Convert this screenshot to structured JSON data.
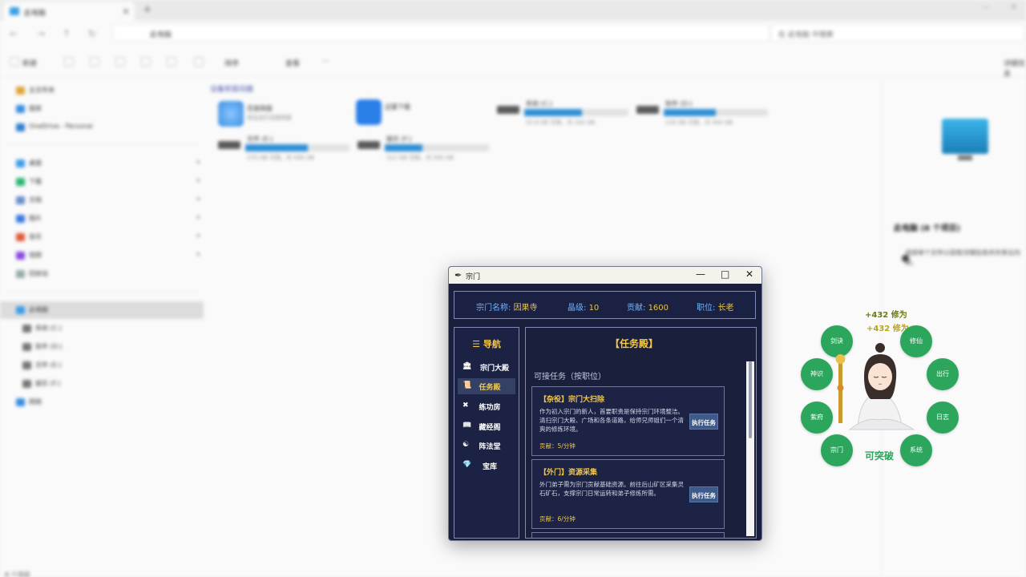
{
  "explorer": {
    "tab_title": "此电脑",
    "path": "此电脑",
    "search_placeholder": "在 此电脑 中搜索",
    "toolbar": {
      "new": "新建",
      "sort": "排序",
      "view": "查看",
      "more": "···",
      "details": "详细信息"
    },
    "sidebar": {
      "top_items": [
        "主文件夹",
        "图库",
        "OneDrive - Personal"
      ],
      "pinned_items": [
        "桌面",
        "下载",
        "文档",
        "图片",
        "音乐",
        "视频",
        "回收站"
      ],
      "this_pc": "此电脑",
      "drives": [
        "系统 (C:)",
        "软件 (D:)",
        "文件 (E:)",
        "娱乐 (F:)"
      ],
      "network": "网络"
    },
    "section_title": "设备和驱动器",
    "apps": [
      {
        "name": "百度网盘",
        "sub": "双击运行百度网盘"
      },
      {
        "name": "迅雷下载",
        "sub": ""
      }
    ],
    "drives": [
      {
        "name": "系统 (C:)",
        "free": "55.8 GB 可用，共 200 GB",
        "used": 0.55
      },
      {
        "name": "软件 (D:)",
        "free": "218 GB 可用，共 400 GB",
        "used": 0.5
      },
      {
        "name": "文件 (E:)",
        "free": "270 GB 可用，共 499 GB",
        "used": 0.6
      },
      {
        "name": "娱乐 (F:)",
        "free": "312 GB 可用，共 500 GB",
        "used": 0.36
      }
    ],
    "details": {
      "title": "此电脑 (8 个项目)",
      "info": "选择单个文件以获取详细信息并共享云内容。"
    },
    "status": "8 个项目"
  },
  "sect_window": {
    "title": "宗门",
    "info": {
      "name_label": "宗门名称:",
      "name_value": "因果寺",
      "level_label": "晶级:",
      "level_value": "10",
      "contrib_label": "贡献:",
      "contrib_value": "1600",
      "position_label": "职位:",
      "position_value": "长老"
    },
    "nav": {
      "heading": "☰ 导航",
      "items": [
        {
          "label": "宗门大殿",
          "icon": "🏛"
        },
        {
          "label": "任务殿",
          "icon": "📜"
        },
        {
          "label": "练功房",
          "icon": "✖"
        },
        {
          "label": "藏经阁",
          "icon": "📖"
        },
        {
          "label": "阵法堂",
          "icon": "☯"
        },
        {
          "label": "宝库",
          "icon": "💎"
        }
      ]
    },
    "content": {
      "title": "【任务殿】",
      "subtitle": "可接任务（按职位）",
      "tasks": [
        {
          "title": "【杂役】宗门大扫除",
          "desc": "作为初入宗门的新人，首要职责是保持宗门环境整洁。清扫宗门大殿、广场和各条道路，给师兄师姐们一个清爽的修炼环境。",
          "contrib": "贡献：5/分钟",
          "button": "执行任务"
        },
        {
          "title": "【外门】资源采集",
          "desc": "外门弟子需为宗门贡献基础资源。前往后山矿区采集灵石矿石，支撑宗门日常运转和弟子修炼所需。",
          "contrib": "贡献：6/分钟",
          "button": "执行任务"
        }
      ]
    }
  },
  "widget": {
    "gain_1": "+432 修为",
    "gain_2": "+432 修为",
    "status": "可突破",
    "orbs": [
      "剑诀",
      "修仙",
      "神识",
      "出行",
      "紫府",
      "日志",
      "宗门",
      "系统"
    ]
  }
}
